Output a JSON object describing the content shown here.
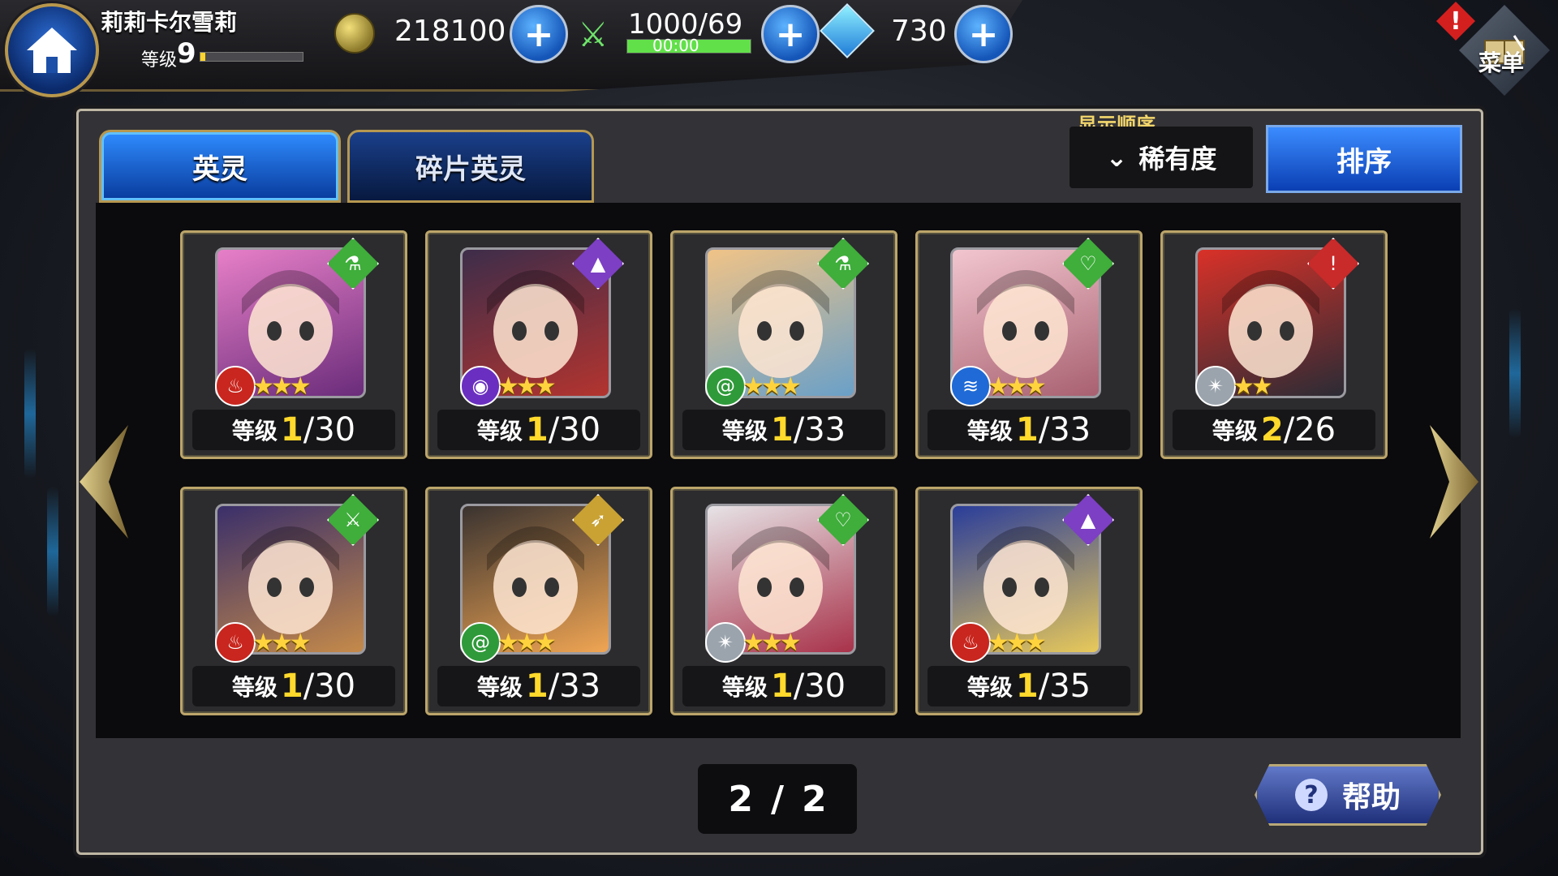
{
  "header": {
    "player_name": "莉莉卡尔雪莉",
    "level_label": "等级",
    "level": "9",
    "exp_fraction": 0.05,
    "gold": "218100",
    "stamina": "1000/69",
    "stamina_fraction": 1.0,
    "stamina_timer": "00:00",
    "gems": "730",
    "plus_label": "+",
    "menu_label": "菜单",
    "alert_label": "!"
  },
  "tabs": [
    {
      "label": "英灵",
      "active": true
    },
    {
      "label": "碎片英灵",
      "active": false
    }
  ],
  "sort": {
    "title": "显示顺序",
    "selected": "稀有度",
    "chevron": "⌄",
    "button_label": "排序"
  },
  "cards": [
    {
      "level_label": "等级",
      "level_current": "1",
      "level_max": "30",
      "stars": "★★★",
      "class_icon": "bottle-icon",
      "class_color": "#3fae3b",
      "class_glyph": "⚗",
      "element_icon": "fire-icon",
      "element_color": "#c8261e",
      "element_glyph": "♨",
      "portrait_colors": [
        "#e77fc8",
        "#6a2c7a"
      ]
    },
    {
      "level_label": "等级",
      "level_current": "1",
      "level_max": "30",
      "stars": "★★★",
      "class_icon": "wizard-hat-icon",
      "class_color": "#7d3fc4",
      "class_glyph": "▲",
      "element_icon": "eye-icon",
      "element_color": "#6a2fc0",
      "element_glyph": "◉",
      "portrait_colors": [
        "#3d2d4a",
        "#b3342f"
      ]
    },
    {
      "level_label": "等级",
      "level_current": "1",
      "level_max": "33",
      "stars": "★★★",
      "class_icon": "bottle-icon",
      "class_color": "#3fae3b",
      "class_glyph": "⚗",
      "element_icon": "wind-icon",
      "element_color": "#2f9a3a",
      "element_glyph": "@",
      "portrait_colors": [
        "#f0c387",
        "#6aa0c8"
      ]
    },
    {
      "level_label": "等级",
      "level_current": "1",
      "level_max": "33",
      "stars": "★★★",
      "class_icon": "heart-icon",
      "class_color": "#3fae3b",
      "class_glyph": "♡",
      "element_icon": "water-icon",
      "element_color": "#1f6ad6",
      "element_glyph": "≋",
      "portrait_colors": [
        "#f2c6cf",
        "#a86070"
      ]
    },
    {
      "level_label": "等级",
      "level_current": "2",
      "level_max": "26",
      "stars": "★★",
      "class_icon": "sword-icon",
      "class_color": "#c92a2a",
      "class_glyph": "!",
      "element_icon": "light-icon",
      "element_color": "#9ba4ad",
      "element_glyph": "✴",
      "portrait_colors": [
        "#d93128",
        "#2b2b35"
      ]
    },
    {
      "level_label": "等级",
      "level_current": "1",
      "level_max": "30",
      "stars": "★★★",
      "class_icon": "sword-icon",
      "class_color": "#3fae3b",
      "class_glyph": "⚔",
      "element_icon": "fire-icon",
      "element_color": "#c8261e",
      "element_glyph": "♨",
      "portrait_colors": [
        "#3a2f6a",
        "#c58a4a"
      ]
    },
    {
      "level_label": "等级",
      "level_current": "1",
      "level_max": "33",
      "stars": "★★★",
      "class_icon": "bow-icon",
      "class_color": "#c9a233",
      "class_glyph": "➶",
      "element_icon": "wind-icon",
      "element_color": "#2f9a3a",
      "element_glyph": "@",
      "portrait_colors": [
        "#3a3330",
        "#f0a553"
      ]
    },
    {
      "level_label": "等级",
      "level_current": "1",
      "level_max": "30",
      "stars": "★★★",
      "class_icon": "heart-icon",
      "class_color": "#3fae3b",
      "class_glyph": "♡",
      "element_icon": "light-icon",
      "element_color": "#9ba4ad",
      "element_glyph": "✴",
      "portrait_colors": [
        "#e6e3e6",
        "#a8324a"
      ]
    },
    {
      "level_label": "等级",
      "level_current": "1",
      "level_max": "35",
      "stars": "★★★",
      "class_icon": "wizard-hat-icon",
      "class_color": "#7d3fc4",
      "class_glyph": "▲",
      "element_icon": "fire-icon",
      "element_color": "#c8261e",
      "element_glyph": "♨",
      "portrait_colors": [
        "#2a3d9a",
        "#e8c95a"
      ]
    }
  ],
  "pager": {
    "current": "2",
    "separator": "/",
    "total": "2"
  },
  "help_button": {
    "label": "帮助",
    "icon_glyph": "?"
  }
}
